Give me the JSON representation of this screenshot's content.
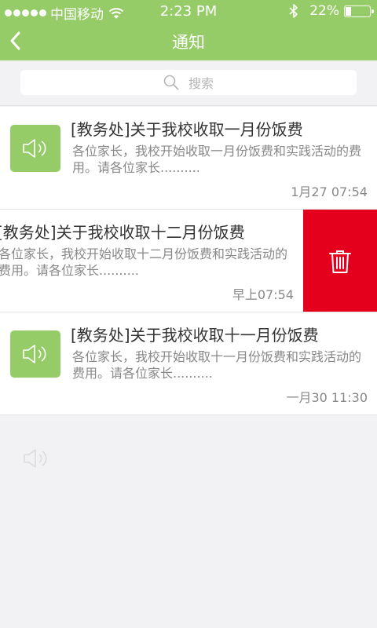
{
  "status_bar": {
    "carrier": "中国移动",
    "time": "2:23 PM",
    "battery_text": "22%",
    "battery_level": 0.22,
    "signal_dots": 5
  },
  "nav": {
    "title": "通知",
    "back_icon": "chevron-left-icon"
  },
  "search": {
    "placeholder": "搜索",
    "icon": "search-icon"
  },
  "notifications": [
    {
      "title": "[教务处]关于我校收取一月份饭费",
      "body": "各位家长，我校开始收取一月份饭费和实践活动的费用。请各位家长..........",
      "time": "1月27 07:54",
      "icon": "speaker-icon"
    },
    {
      "title": "[教务处]关于我校收取十二月份饭费",
      "body": "各位家长，我校开始收取十二月份饭费和实践活动的费用。请各位家长..........",
      "time": "早上07:54",
      "icon": "speaker-icon",
      "swiped": true,
      "delete_icon": "trash-icon"
    },
    {
      "title": "[教务处]关于我校收取十一月份饭费",
      "body": "各位家长，我校开始收取十一月份饭费和实践活动的费用。请各位家长..........",
      "time": "一月30 11:30",
      "icon": "speaker-icon"
    }
  ],
  "colors": {
    "header_green": "#96cc68",
    "delete_red": "#e4001c",
    "background": "#f2f2f4"
  }
}
